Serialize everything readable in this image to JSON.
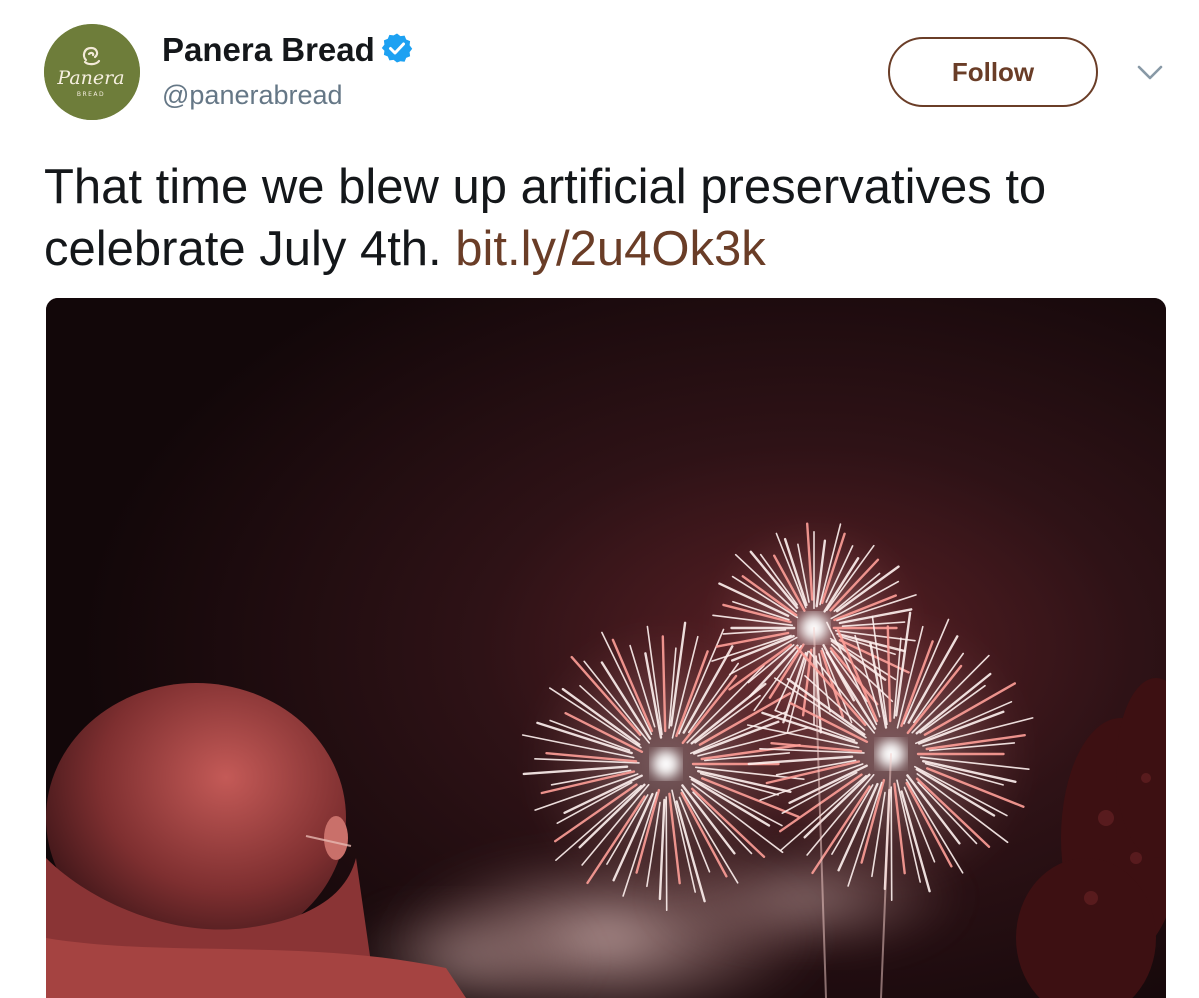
{
  "tweet": {
    "author": {
      "display_name": "Panera Bread",
      "handle": "@panerabread",
      "verified": true,
      "avatar_logo_text": "Panera",
      "avatar_logo_subtext": "BREAD"
    },
    "follow_label": "Follow",
    "more_icon": "chevron-down-icon",
    "text": "That time we blew up artificial preservatives to celebrate July 4th. ",
    "link_text": "bit.ly/2u4Ok3k",
    "media": {
      "type": "photo",
      "subject": "fireworks-night"
    }
  },
  "colors": {
    "brand_brown": "#6a3d27",
    "avatar_green": "#6e7d3a",
    "verified_blue": "#1da1f2",
    "handle_gray": "#657786",
    "text_black": "#14171a"
  }
}
